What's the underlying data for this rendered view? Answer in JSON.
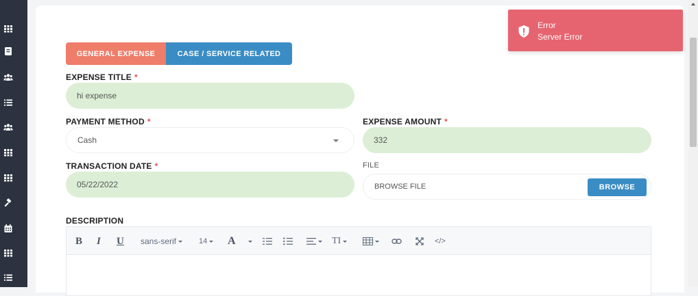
{
  "sidebar": {
    "items": [
      {
        "icon": "grid-icon"
      },
      {
        "icon": "book-icon"
      },
      {
        "icon": "users-icon"
      },
      {
        "icon": "list-icon"
      },
      {
        "icon": "users-icon"
      },
      {
        "icon": "grid-icon"
      },
      {
        "icon": "grid-icon"
      },
      {
        "icon": "gavel-icon"
      },
      {
        "icon": "calendar-icon"
      },
      {
        "icon": "grid-icon"
      },
      {
        "icon": "list-icon"
      }
    ]
  },
  "tabs": {
    "general": "GENERAL EXPENSE",
    "case": "CASE / SERVICE RELATED"
  },
  "form": {
    "expense_title": {
      "label": "EXPENSE TITLE",
      "required": "*",
      "value": "hi expense"
    },
    "payment_method": {
      "label": "PAYMENT METHOD",
      "required": "*",
      "value": "Cash"
    },
    "expense_amount": {
      "label": "EXPENSE AMOUNT",
      "required": "*",
      "value": "332"
    },
    "transaction_date": {
      "label": "TRANSACTION DATE",
      "required": "*",
      "value": "05/22/2022"
    },
    "file": {
      "label": "FILE",
      "placeholder": "BROWSE FILE",
      "button": "BROWSE"
    },
    "description": {
      "label": "DESCRIPTION"
    }
  },
  "toolbar": {
    "bold": "B",
    "italic": "I",
    "underline": "U",
    "font_family": "sans-serif",
    "font_size": "14",
    "font_color": "A",
    "ordered_list_icon": "ordered-list-icon",
    "unordered_list_icon": "unordered-list-icon",
    "align_icon": "align-icon",
    "line_height": "TI",
    "table_icon": "table-icon",
    "link_icon": "link-icon",
    "fullscreen_icon": "fullscreen-icon",
    "code": "</>"
  },
  "toast": {
    "title": "Error",
    "message": "Server Error",
    "color": "#e66470"
  },
  "colors": {
    "tab_general": "#ee7d6a",
    "tab_case": "#3a8cc4",
    "field_filled": "#dcefd6",
    "sidebar": "#2c323f",
    "required": "#e05252"
  }
}
